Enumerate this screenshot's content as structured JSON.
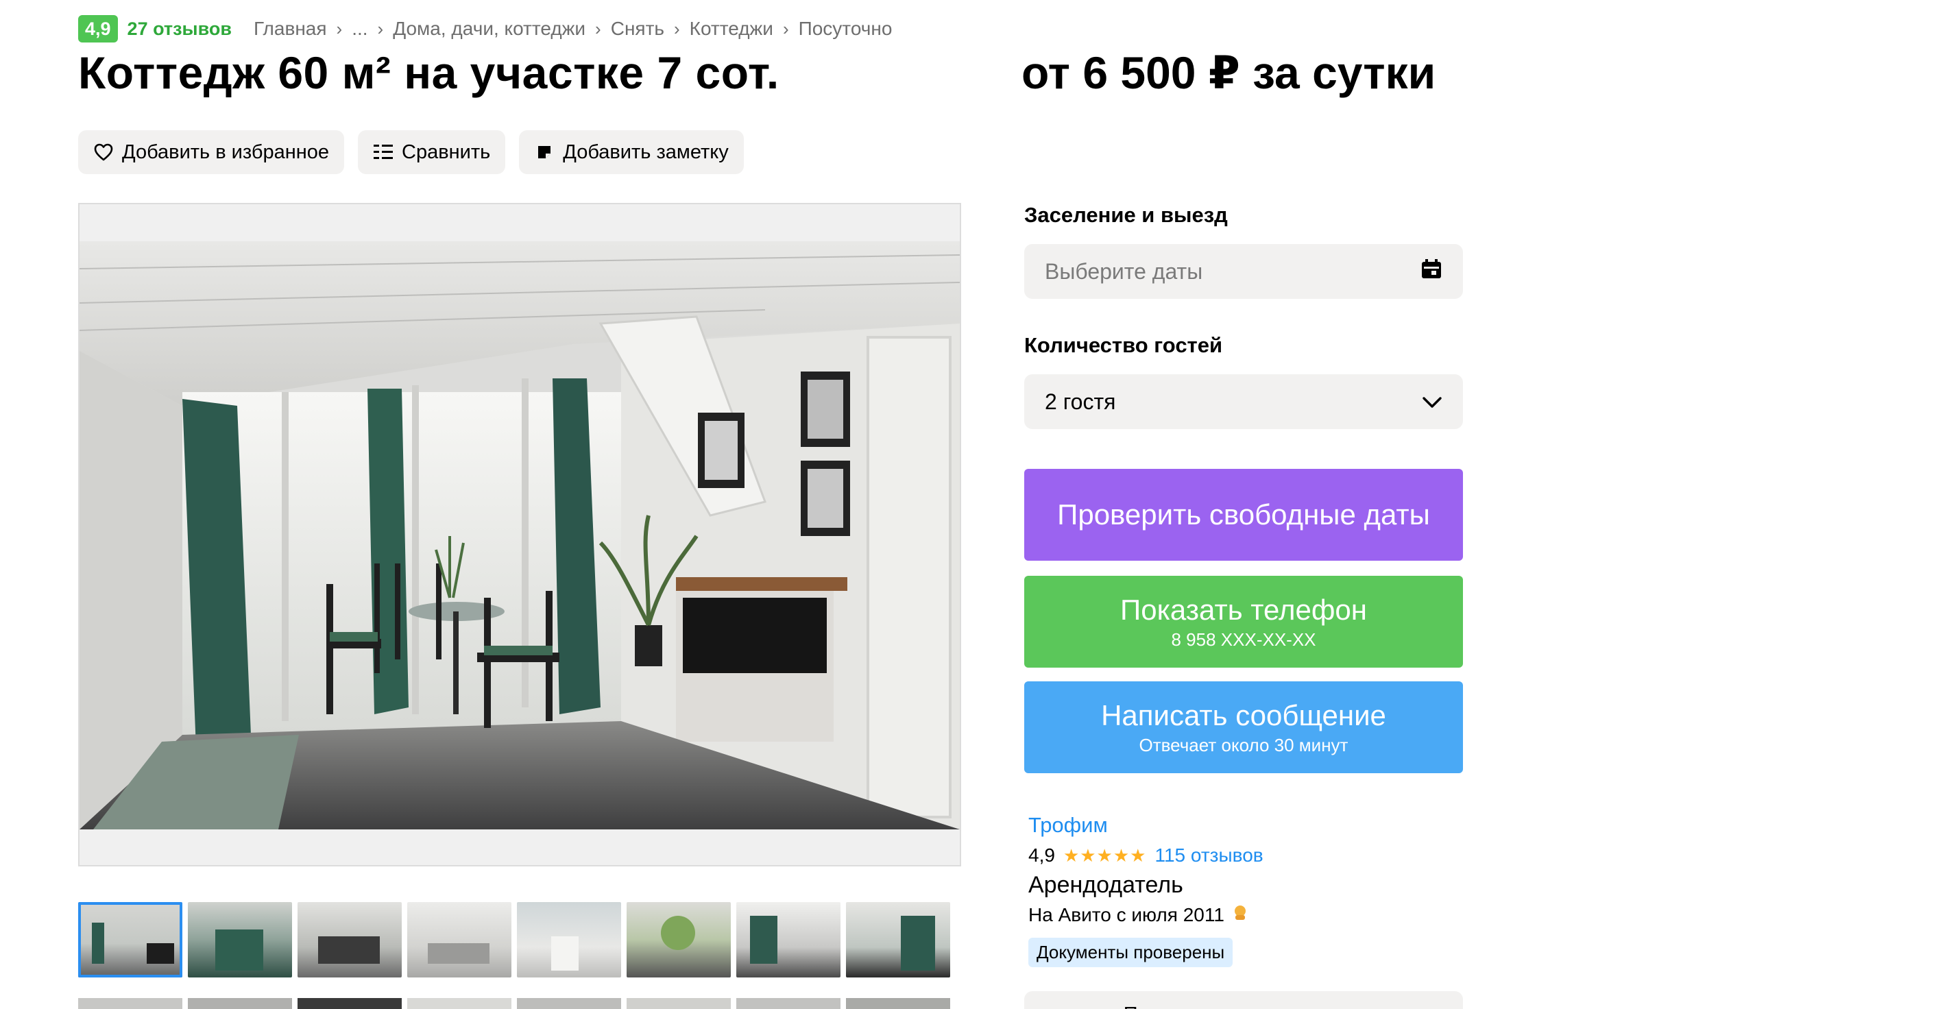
{
  "header": {
    "rating": "4,9",
    "reviews": "27 отзывов",
    "breadcrumbs": [
      "Главная",
      "...",
      "Дома, дачи, коттеджи",
      "Снять",
      "Коттеджи",
      "Посуточно"
    ]
  },
  "listing": {
    "title": "Коттедж 60 м² на участке 7 сот.",
    "price": "от 6 500 ₽ за сутки"
  },
  "actions": {
    "favorite": "Добавить в избранное",
    "compare": "Сравнить",
    "note": "Добавить заметку"
  },
  "booking": {
    "dates_label": "Заселение и выезд",
    "dates_placeholder": "Выберите даты",
    "guests_label": "Количество гостей",
    "guests_value": "2 гостя",
    "check_button": "Проверить свободные даты",
    "phone_button": "Показать телефон",
    "phone_number": "8 958 XXX-XX-XX",
    "message_button": "Написать сообщение",
    "message_sub": "Отвечает около 30 минут",
    "colors": {
      "check": "#9b63f0",
      "phone": "#5bc75a",
      "message": "#4aa9f5"
    }
  },
  "seller": {
    "name": "Трофим",
    "rating": "4,9",
    "stars": 5,
    "reviews": "115 отзывов",
    "type": "Арендодатель",
    "since": "На Авито с июля 2011",
    "docs_badge": "Документы проверены",
    "subscribe": "Подписаться на продавца"
  },
  "gallery": {
    "thumbnails_row1": 8,
    "thumbnails_row2": 8,
    "active_index": 0
  }
}
